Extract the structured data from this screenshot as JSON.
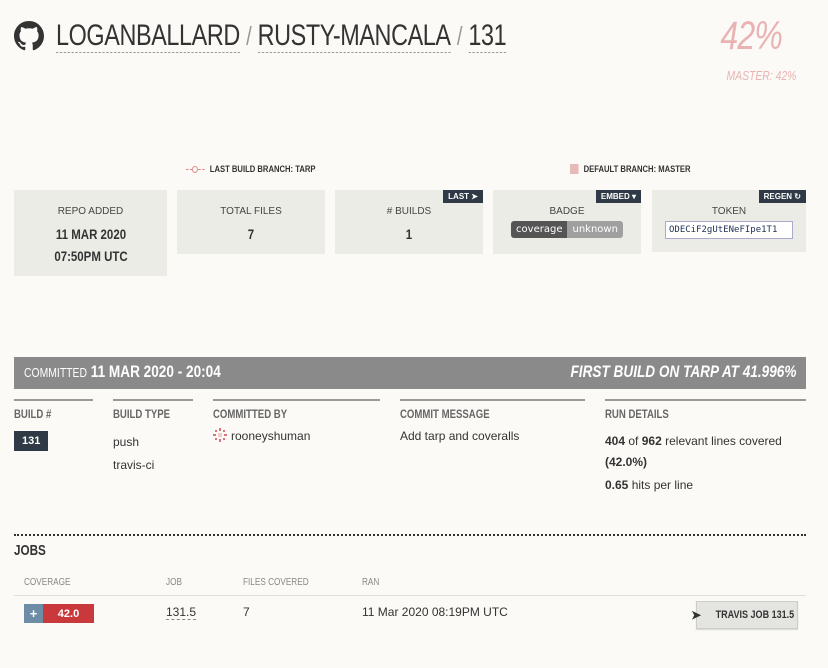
{
  "header": {
    "owner": "LOGANBALLARD",
    "repo": "RUSTY-MANCALA",
    "build": "131",
    "separator": "/",
    "coverage_pct": "42%",
    "master_label": "MASTER: 42%"
  },
  "legend": {
    "last_build": "LAST BUILD BRANCH: TARP",
    "default_branch": "DEFAULT BRANCH: MASTER"
  },
  "stats": {
    "repo_added_label": "REPO ADDED",
    "repo_added_value": "11 MAR 2020 07:50PM UTC",
    "total_files_label": "TOTAL FILES",
    "total_files_value": "7",
    "builds_label": "# BUILDS",
    "builds_value": "1",
    "builds_tag": "LAST",
    "badge_label": "BADGE",
    "badge_tag": "EMBED",
    "badge_left": "coverage",
    "badge_right": "unknown",
    "token_label": "TOKEN",
    "token_tag": "REGEN",
    "token_value": "ODECiF2gUtENeFIpe1T1"
  },
  "commit_bar": {
    "committed_label": "COMMITTED",
    "committed_date": "11 MAR 2020 - 20:04",
    "first_build": "FIRST BUILD ON TARP AT 41.996%"
  },
  "details": {
    "build_num_head": "BUILD #",
    "build_num": "131",
    "build_type_head": "BUILD TYPE",
    "build_type_1": "push",
    "build_type_2": "travis-ci",
    "committed_by_head": "COMMITTED BY",
    "committed_by": "rooneyshuman",
    "commit_msg_head": "COMMIT MESSAGE",
    "commit_msg": "Add tarp and coveralls",
    "run_details_head": "RUN DETAILS",
    "lines_covered": "404",
    "lines_of": "of",
    "lines_relevant": "962",
    "lines_suffix": "relevant lines covered",
    "lines_pct": "(42.0%)",
    "hits": "0.65",
    "hits_suffix": "hits per line"
  },
  "jobs": {
    "title": "JOBS",
    "columns": [
      "COVERAGE",
      "JOB",
      "FILES COVERED",
      "RAN"
    ],
    "rows": [
      {
        "coverage": "42.0",
        "job": "131.5",
        "files": "7",
        "ran": "11 Mar 2020 08:19PM UTC",
        "button": "TRAVIS JOB 131.5"
      }
    ]
  },
  "colors": {
    "accent_pink": "#e9b3b3",
    "bar_gray": "#8a8a8a",
    "dark_chip": "#2f3a46",
    "coverage_red": "#c9393b"
  }
}
